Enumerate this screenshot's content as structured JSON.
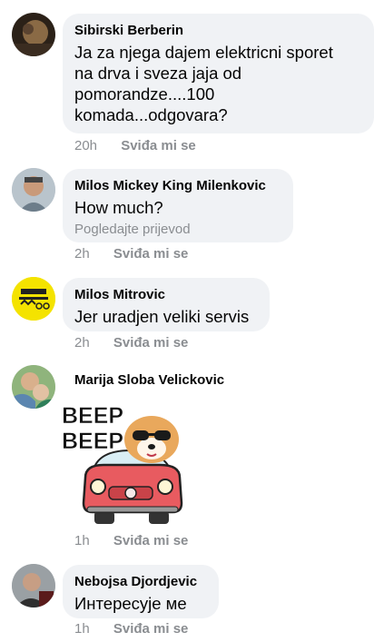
{
  "comments": [
    {
      "author": "Sibirski Berberin",
      "text_lines": [
        "Ja za njega dajem elektricni sporet",
        "na drva i sveza jaja od",
        "pomorandze....100",
        "komada...odgovara?"
      ],
      "time": "20h",
      "like_label": "Sviđa mi se",
      "avatar_icon": "profile-photo-icon"
    },
    {
      "author": "Milos Mickey King Milenkovic",
      "text": "How much?",
      "translate_label": "Pogledajte prijevod",
      "time": "2h",
      "like_label": "Sviđa mi se",
      "avatar_icon": "profile-photo-icon"
    },
    {
      "author": "Milos Mitrovic",
      "text": "Jer uradjen veliki servis",
      "time": "2h",
      "like_label": "Sviđa mi se",
      "avatar_icon": "horse-carriage-logo-icon"
    },
    {
      "author": "Marija Sloba Velickovic",
      "sticker_text": [
        "BEEP",
        "BEEP"
      ],
      "sticker_icon": "dog-in-car-sticker",
      "time": "1h",
      "like_label": "Sviđa mi se",
      "avatar_icon": "profile-photo-icon"
    },
    {
      "author": "Nebojsa Djordjevic",
      "text": "Интересује ме",
      "time": "1h",
      "like_label": "Sviđa mi se",
      "avatar_icon": "profile-photo-icon"
    }
  ],
  "colors": {
    "bubble": "#f0f2f5",
    "meta": "#8a8d91",
    "sticker_car": "#e85b60"
  }
}
